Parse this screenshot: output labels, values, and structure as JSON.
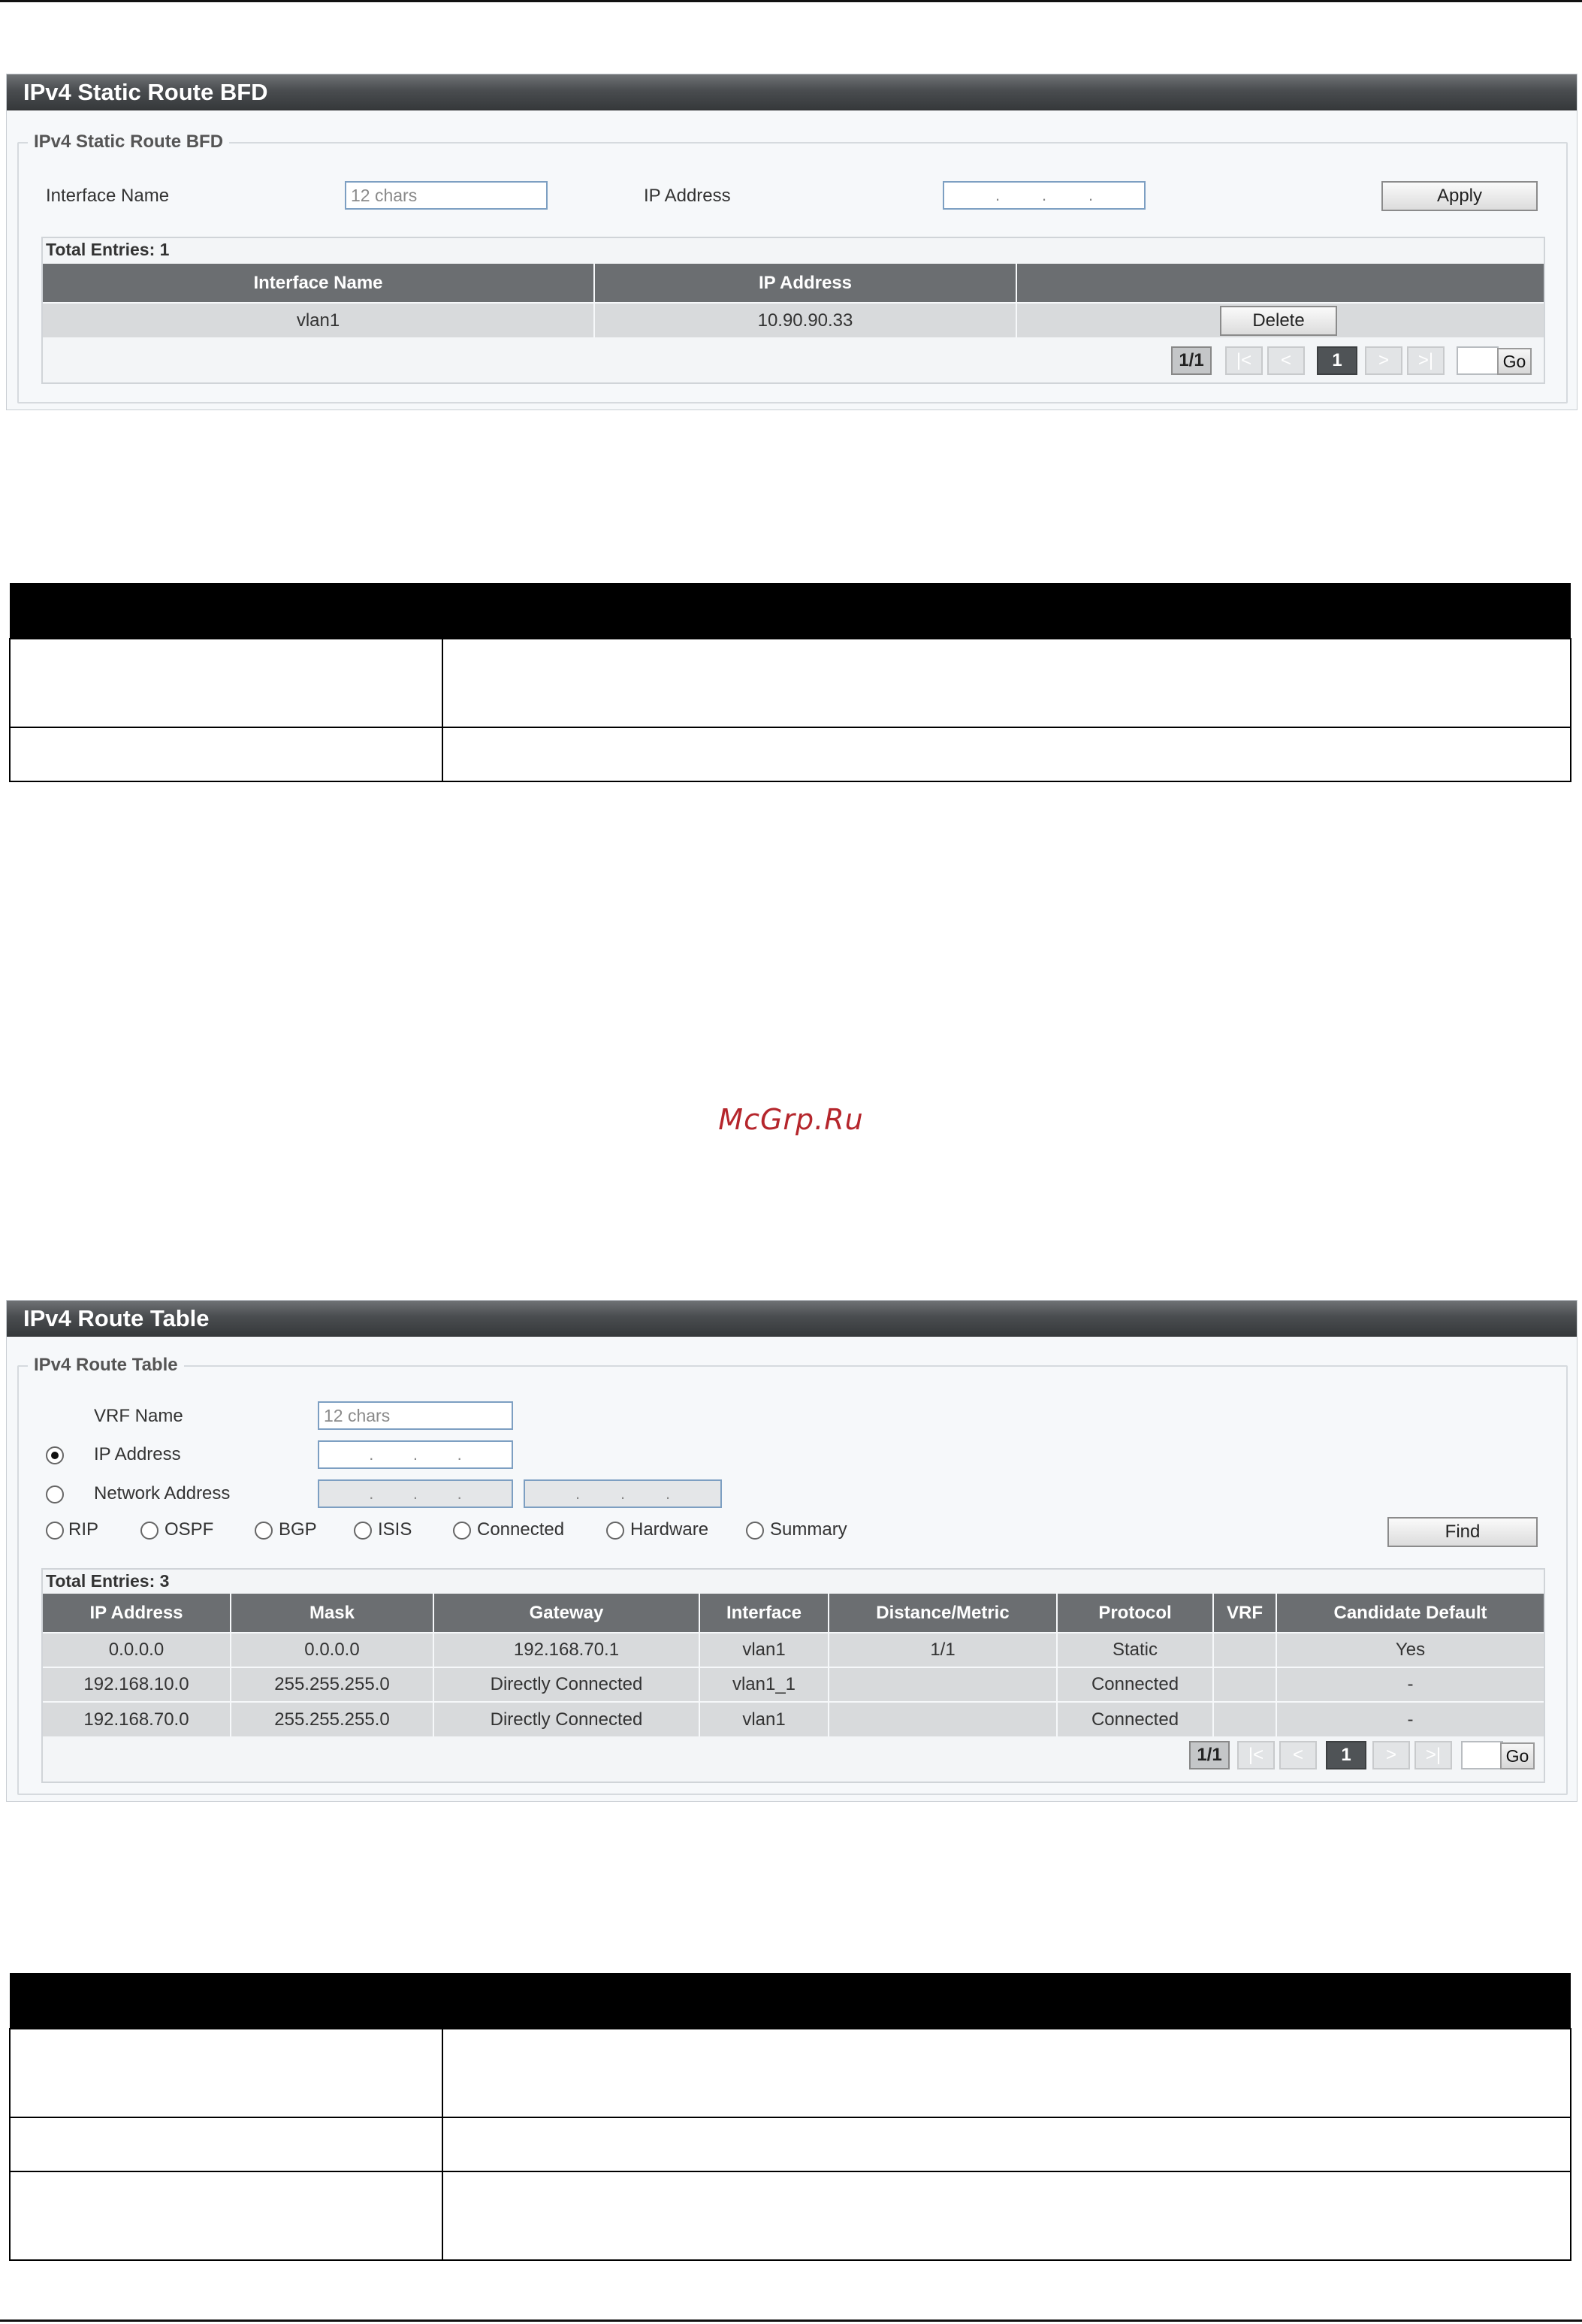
{
  "watermark": "McGrp.Ru",
  "bfd": {
    "title": "IPv4 Static Route BFD",
    "legend": "IPv4 Static Route BFD",
    "interface_label": "Interface Name",
    "interface_placeholder": "12 chars",
    "ip_label": "IP Address",
    "apply_label": "Apply",
    "total": "Total Entries: 1",
    "columns": [
      "Interface Name",
      "IP Address",
      ""
    ],
    "rows": [
      {
        "interface": "vlan1",
        "ip": "10.90.90.33",
        "action": "Delete"
      }
    ],
    "pager": {
      "count": "1/1",
      "first": "|<",
      "prev": "<",
      "page": "1",
      "next": ">",
      "last": ">|",
      "go": "Go"
    }
  },
  "route": {
    "title": "IPv4 Route Table",
    "legend": "IPv4 Route Table",
    "vrf_label": "VRF Name",
    "vrf_placeholder": "12 chars",
    "ip_label": "IP Address",
    "network_label": "Network Address",
    "selected_mode": "IP Address",
    "protocols": [
      "RIP",
      "OSPF",
      "BGP",
      "ISIS",
      "Connected",
      "Hardware",
      "Summary"
    ],
    "find_label": "Find",
    "total": "Total Entries: 3",
    "columns": [
      "IP Address",
      "Mask",
      "Gateway",
      "Interface",
      "Distance/Metric",
      "Protocol",
      "VRF",
      "Candidate Default"
    ],
    "rows": [
      [
        "0.0.0.0",
        "0.0.0.0",
        "192.168.70.1",
        "vlan1",
        "1/1",
        "Static",
        "",
        "Yes"
      ],
      [
        "192.168.10.0",
        "255.255.255.0",
        "Directly Connected",
        "vlan1_1",
        "",
        "Connected",
        "",
        "-"
      ],
      [
        "192.168.70.0",
        "255.255.255.0",
        "Directly Connected",
        "vlan1",
        "",
        "Connected",
        "",
        "-"
      ]
    ],
    "pager": {
      "count": "1/1",
      "first": "|<",
      "prev": "<",
      "page": "1",
      "next": ">",
      "last": ">|",
      "go": "Go"
    }
  }
}
